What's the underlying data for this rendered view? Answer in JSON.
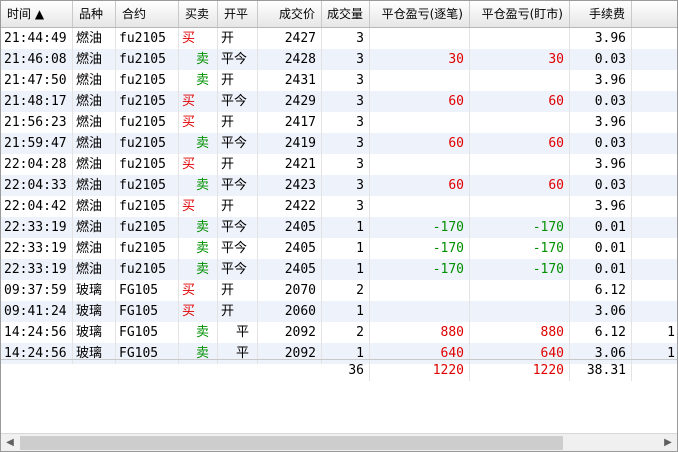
{
  "columns": [
    {
      "label": "时间 ▲",
      "w": 72,
      "align": "left"
    },
    {
      "label": "品种",
      "w": 43,
      "align": "left"
    },
    {
      "label": "合约",
      "w": 63,
      "align": "left"
    },
    {
      "label": "买卖",
      "w": 39,
      "align": "left"
    },
    {
      "label": "开平",
      "w": 40,
      "align": "left"
    },
    {
      "label": "成交价",
      "w": 64,
      "align": "right"
    },
    {
      "label": "成交量",
      "w": 48,
      "align": "right"
    },
    {
      "label": "平仓盈亏(逐笔)",
      "w": 100,
      "align": "right"
    },
    {
      "label": "平仓盈亏(盯市)",
      "w": 100,
      "align": "right"
    },
    {
      "label": "手续费",
      "w": 62,
      "align": "right"
    },
    {
      "label": "",
      "w": 49,
      "align": "right"
    }
  ],
  "rows": [
    {
      "time": "21:44:49",
      "variety": "燃油",
      "contract": "fu2105",
      "side": "买",
      "offset": "开",
      "price": "2427",
      "qty": "3",
      "pnl_trade": "",
      "pnl_mtm": "",
      "fee": "3.96",
      "extra": ""
    },
    {
      "time": "21:46:08",
      "variety": "燃油",
      "contract": "fu2105",
      "side": "卖",
      "offset": "平今",
      "price": "2428",
      "qty": "3",
      "pnl_trade": "30",
      "pnl_mtm": "30",
      "fee": "0.03",
      "extra": ""
    },
    {
      "time": "21:47:50",
      "variety": "燃油",
      "contract": "fu2105",
      "side": "卖",
      "offset": "开",
      "price": "2431",
      "qty": "3",
      "pnl_trade": "",
      "pnl_mtm": "",
      "fee": "3.96",
      "extra": ""
    },
    {
      "time": "21:48:17",
      "variety": "燃油",
      "contract": "fu2105",
      "side": "买",
      "offset": "平今",
      "price": "2429",
      "qty": "3",
      "pnl_trade": "60",
      "pnl_mtm": "60",
      "fee": "0.03",
      "extra": ""
    },
    {
      "time": "21:56:23",
      "variety": "燃油",
      "contract": "fu2105",
      "side": "买",
      "offset": "开",
      "price": "2417",
      "qty": "3",
      "pnl_trade": "",
      "pnl_mtm": "",
      "fee": "3.96",
      "extra": ""
    },
    {
      "time": "21:59:47",
      "variety": "燃油",
      "contract": "fu2105",
      "side": "卖",
      "offset": "平今",
      "price": "2419",
      "qty": "3",
      "pnl_trade": "60",
      "pnl_mtm": "60",
      "fee": "0.03",
      "extra": ""
    },
    {
      "time": "22:04:28",
      "variety": "燃油",
      "contract": "fu2105",
      "side": "买",
      "offset": "开",
      "price": "2421",
      "qty": "3",
      "pnl_trade": "",
      "pnl_mtm": "",
      "fee": "3.96",
      "extra": ""
    },
    {
      "time": "22:04:33",
      "variety": "燃油",
      "contract": "fu2105",
      "side": "卖",
      "offset": "平今",
      "price": "2423",
      "qty": "3",
      "pnl_trade": "60",
      "pnl_mtm": "60",
      "fee": "0.03",
      "extra": ""
    },
    {
      "time": "22:04:42",
      "variety": "燃油",
      "contract": "fu2105",
      "side": "买",
      "offset": "开",
      "price": "2422",
      "qty": "3",
      "pnl_trade": "",
      "pnl_mtm": "",
      "fee": "3.96",
      "extra": ""
    },
    {
      "time": "22:33:19",
      "variety": "燃油",
      "contract": "fu2105",
      "side": "卖",
      "offset": "平今",
      "price": "2405",
      "qty": "1",
      "pnl_trade": "-170",
      "pnl_mtm": "-170",
      "fee": "0.01",
      "extra": ""
    },
    {
      "time": "22:33:19",
      "variety": "燃油",
      "contract": "fu2105",
      "side": "卖",
      "offset": "平今",
      "price": "2405",
      "qty": "1",
      "pnl_trade": "-170",
      "pnl_mtm": "-170",
      "fee": "0.01",
      "extra": ""
    },
    {
      "time": "22:33:19",
      "variety": "燃油",
      "contract": "fu2105",
      "side": "卖",
      "offset": "平今",
      "price": "2405",
      "qty": "1",
      "pnl_trade": "-170",
      "pnl_mtm": "-170",
      "fee": "0.01",
      "extra": ""
    },
    {
      "time": "09:37:59",
      "variety": "玻璃",
      "contract": "FG105",
      "side": "买",
      "offset": "开",
      "price": "2070",
      "qty": "2",
      "pnl_trade": "",
      "pnl_mtm": "",
      "fee": "6.12",
      "extra": ""
    },
    {
      "time": "09:41:24",
      "variety": "玻璃",
      "contract": "FG105",
      "side": "买",
      "offset": "开",
      "price": "2060",
      "qty": "1",
      "pnl_trade": "",
      "pnl_mtm": "",
      "fee": "3.06",
      "extra": ""
    },
    {
      "time": "14:24:56",
      "variety": "玻璃",
      "contract": "FG105",
      "side": "卖",
      "offset": "平",
      "price": "2092",
      "qty": "2",
      "pnl_trade": "880",
      "pnl_mtm": "880",
      "fee": "6.12",
      "extra": "1"
    },
    {
      "time": "14:24:56",
      "variety": "玻璃",
      "contract": "FG105",
      "side": "卖",
      "offset": "平",
      "price": "2092",
      "qty": "1",
      "pnl_trade": "640",
      "pnl_mtm": "640",
      "fee": "3.06",
      "extra": "1"
    }
  ],
  "totals": {
    "qty": "36",
    "pnl_trade": "1220",
    "pnl_mtm": "1220",
    "fee": "38.31"
  },
  "scrollbar": {
    "left_arrow": "◀",
    "right_arrow": "▶"
  },
  "colors": {
    "buy": "#e00000",
    "sell": "#009000",
    "loss": "#009000",
    "profit": "#e00000",
    "alt_row": "#eef2fa"
  }
}
